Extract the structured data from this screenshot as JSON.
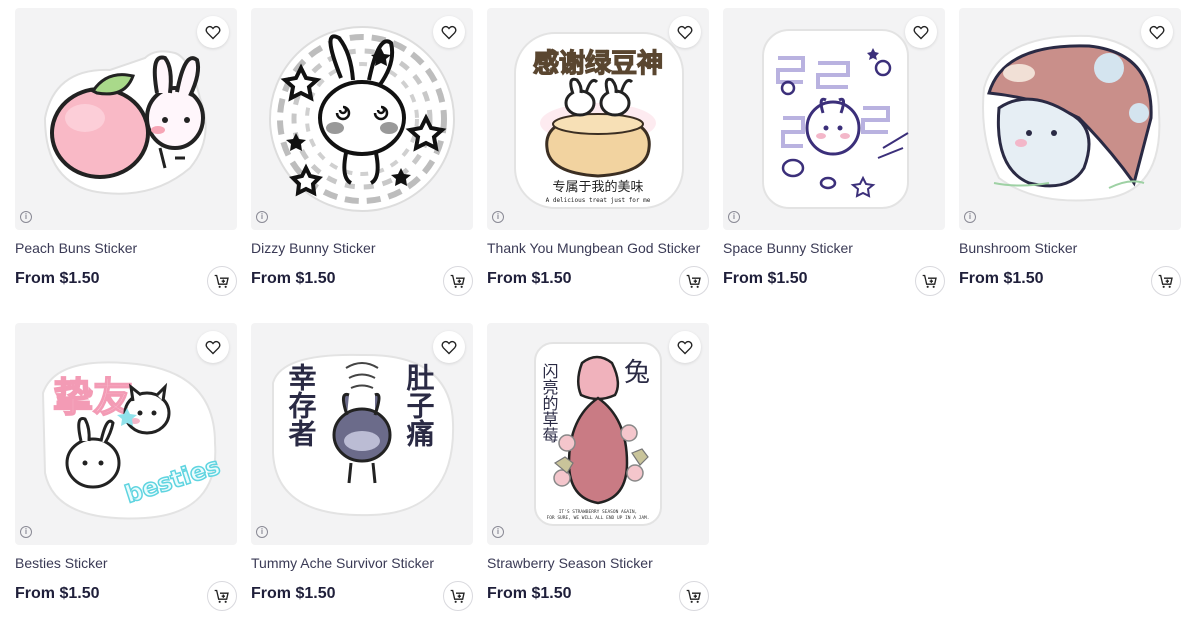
{
  "products": [
    {
      "title": "Peach Buns Sticker",
      "price": "From $1.50",
      "icon": "peach-bunny-sticker-image"
    },
    {
      "title": "Dizzy Bunny Sticker",
      "price": "From $1.50",
      "icon": "dizzy-bunny-sticker-image"
    },
    {
      "title": "Thank You Mungbean God Sticker",
      "price": "From $1.50",
      "icon": "mungbean-cake-sticker-image",
      "art_text": [
        "感谢绿豆神",
        "专属于我的美味",
        "A delicious treat just for me"
      ]
    },
    {
      "title": "Space Bunny Sticker",
      "price": "From $1.50",
      "icon": "space-bunny-sticker-image"
    },
    {
      "title": "Bunshroom Sticker",
      "price": "From $1.50",
      "icon": "mushroom-bunny-sticker-image"
    },
    {
      "title": "Besties Sticker",
      "price": "From $1.50",
      "icon": "besties-sticker-image",
      "art_text": [
        "挚友",
        "besties"
      ]
    },
    {
      "title": "Tummy Ache Survivor Sticker",
      "price": "From $1.50",
      "icon": "tummy-ache-sticker-image",
      "art_text": [
        "幸存者",
        "肚子痛"
      ]
    },
    {
      "title": "Strawberry Season Sticker",
      "price": "From $1.50",
      "icon": "strawberry-bunny-sticker-image",
      "art_text": [
        "闪亮的草莓",
        "兔",
        "IT'S STRAWBERRY SEASON AGAIN,",
        "FOR SURE, WE WILL ALL END UP IN A JAM."
      ]
    }
  ],
  "icons": {
    "favorite": "heart-icon",
    "info": "info-icon",
    "cart": "add-to-cart-icon"
  },
  "colors": {
    "thumb_bg": "#f3f3f4",
    "text": "#3a3a55",
    "price": "#1f1f3a",
    "ink": "#2a2340"
  }
}
